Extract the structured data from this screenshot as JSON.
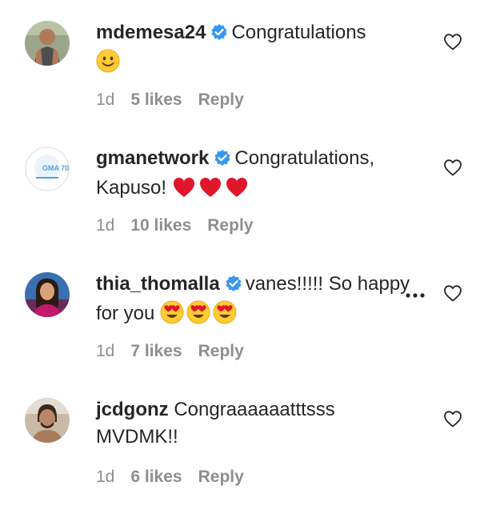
{
  "comments": [
    {
      "username": "mdemesa24",
      "text": "Congratulations",
      "emojis": [
        "smiling-face-icon"
      ],
      "time": "1d",
      "likes": "5 likes",
      "reply": "Reply"
    },
    {
      "username": "gmanetwork",
      "text": "Congratulations, Kapuso!",
      "emojis": [
        "red-heart-icon",
        "red-heart-icon",
        "red-heart-icon"
      ],
      "time": "1d",
      "likes": "10 likes",
      "reply": "Reply"
    },
    {
      "username": "thia_thomalla",
      "text": "vanes!!!!! So happy for you",
      "emojis": [
        "heart-eyes-face-icon",
        "heart-eyes-face-icon",
        "heart-eyes-face-icon"
      ],
      "time": "1d",
      "likes": "7 likes",
      "reply": "Reply"
    },
    {
      "username": "jcdgonz",
      "text": "Congraaaaaatttsss MVDMK!!",
      "emojis": [],
      "time": "1d",
      "likes": "6 likes",
      "reply": "Reply"
    }
  ],
  "avatar_logo_text": "GMA 70",
  "colors": {
    "verified": "#3897f0",
    "muted": "#8e8e8e",
    "heart_emoji": "#e0162b"
  }
}
